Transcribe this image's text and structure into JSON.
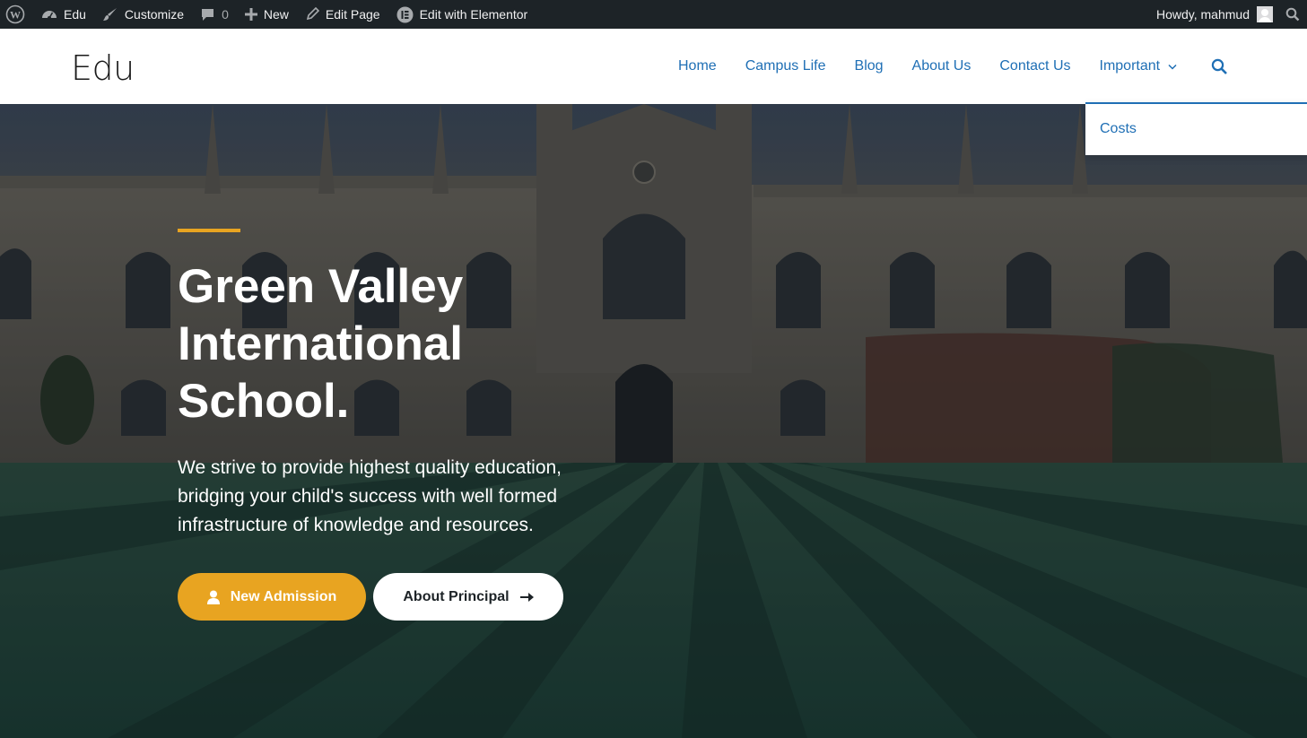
{
  "adminbar": {
    "site_name": "Edu",
    "customize": "Customize",
    "comments_count": "0",
    "new": "New",
    "edit_page": "Edit Page",
    "edit_elementor": "Edit with Elementor",
    "howdy": "Howdy, mahmud"
  },
  "header": {
    "site_title": "Edu",
    "nav": [
      "Home",
      "Campus Life",
      "Blog",
      "About Us",
      "Contact Us",
      "Important"
    ],
    "dropdown": [
      "Costs"
    ]
  },
  "hero": {
    "title_line1": "Green Valley",
    "title_line2": "International",
    "title_line3": "School.",
    "description_line1": "We strive to provide highest quality education,",
    "description_line2": "bridging your child's success with well formed",
    "description_line3": "infrastructure of knowledge and resources.",
    "primary_button": "New Admission",
    "secondary_button": "About Principal"
  },
  "colors": {
    "accent": "#e8a421",
    "link": "#1f6fb5",
    "adminbar": "#1d2327"
  },
  "icons": [
    "wordpress-icon",
    "dashboard-icon",
    "brush-icon",
    "comment-icon",
    "plus-icon",
    "pencil-icon",
    "elementor-icon",
    "avatar-icon",
    "search-icon",
    "chevron-down-icon",
    "user-icon",
    "arrow-right-icon"
  ]
}
